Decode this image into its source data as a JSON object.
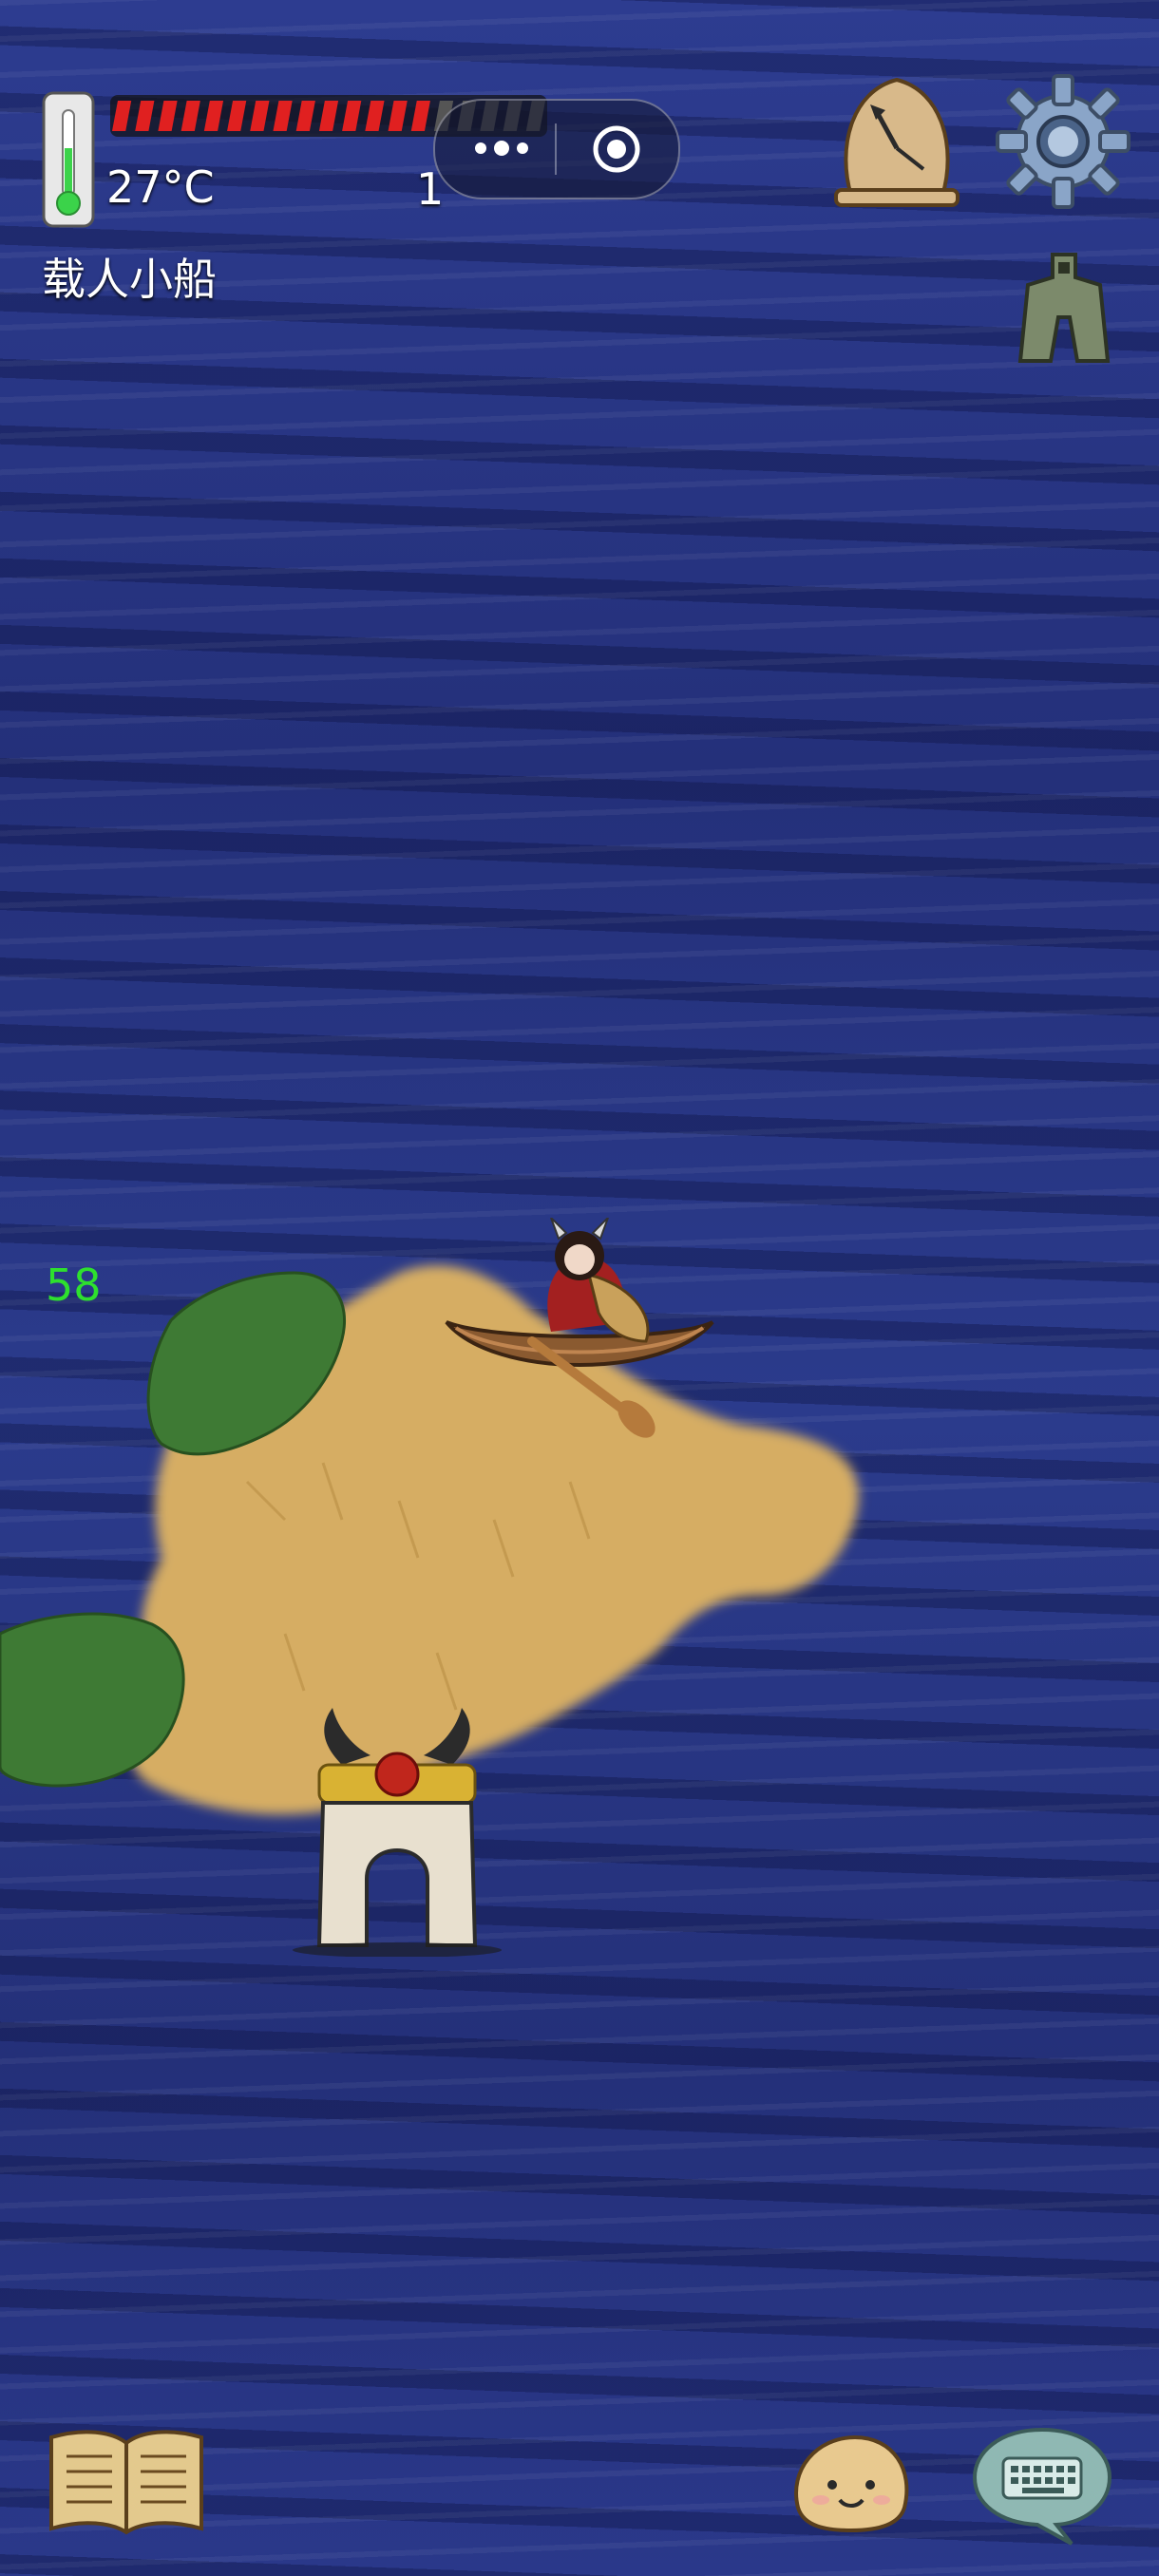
{
  "hud": {
    "temperature": "27°C",
    "item_label": "载人小船",
    "counter": "1",
    "fps": "58",
    "health": {
      "filled_segments": 14,
      "total_segments": 19
    }
  },
  "icons": {
    "thermometer": "thermometer-icon",
    "clock": "clock-icon",
    "settings": "gear-icon",
    "coin": "spade-coin-icon",
    "tech_book": "book-icon",
    "emote": "face-icon",
    "chat": "keyboard-chat-icon",
    "miniprogram_more": "more-dots-icon",
    "miniprogram_close": "target-close-icon"
  },
  "colors": {
    "health_fill": "#e02020",
    "health_empty": "#555555",
    "fps_text": "#2ee02e",
    "sea": "#27357e",
    "sand": "#d6ad63",
    "grass": "#3e7a34"
  }
}
